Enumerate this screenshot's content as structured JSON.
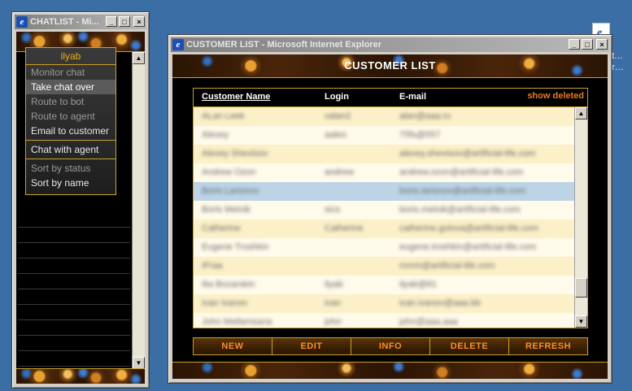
{
  "chat_window": {
    "title": "CHATLIST - Mi...",
    "buttons": {
      "minimize": "_",
      "maximize": "□",
      "close": "×"
    },
    "context_menu": {
      "header": "ilyab",
      "items": [
        {
          "label": "Monitor chat",
          "state": "disabled"
        },
        {
          "label": "Take chat over",
          "state": "active"
        },
        {
          "label": "Route to bot",
          "state": "disabled"
        },
        {
          "label": "Route to agent",
          "state": "disabled"
        },
        {
          "label": "Email to customer",
          "state": "enabled"
        },
        {
          "label": "Chat with agent",
          "state": "enabled"
        },
        {
          "label": "Sort by status",
          "state": "disabled"
        },
        {
          "label": "Sort by name",
          "state": "enabled"
        }
      ]
    },
    "scroll": {
      "up": "▲",
      "down": "▼"
    }
  },
  "customer_window": {
    "title": "CUSTOMER LIST - Microsoft Internet Explorer",
    "buttons": {
      "minimize": "_",
      "maximize": "□",
      "close": "×"
    },
    "heading": "CUSTOMER LIST",
    "table": {
      "columns": {
        "name": "Customer Name",
        "login": "Login",
        "email": "E-mail"
      },
      "show_deleted": "show deleted",
      "rows": [
        {
          "name": "ALan Leek",
          "login": "valan2",
          "email": "alan@aaa.ru",
          "selected": false
        },
        {
          "name": "Alexey",
          "login": "aaleo",
          "email": "75fs@557",
          "selected": false
        },
        {
          "name": "Alexey Shevtsov",
          "login": "",
          "email": "alexey.shevtsov@artificial-life.com",
          "selected": false
        },
        {
          "name": "Andrew Ozon",
          "login": "andrew",
          "email": "andrew.ozon@artificial-life.com",
          "selected": false
        },
        {
          "name": "Boris Larionov",
          "login": "",
          "email": "boris.larionov@artificial-life.com",
          "selected": true
        },
        {
          "name": "Boris Melnik",
          "login": "sics",
          "email": "boris.melnik@artificial-life.com",
          "selected": false
        },
        {
          "name": "Catherine",
          "login": "Catherine",
          "email": "catherine.golova@artificial-life.com",
          "selected": false
        },
        {
          "name": "Eugene Troshkin",
          "login": "",
          "email": "eugene.troshkin@artificial-life.com",
          "selected": false
        },
        {
          "name": "IFraa",
          "login": "",
          "email": "mmm@artificial-life.com",
          "selected": false
        },
        {
          "name": "Ilia Bozarskin",
          "login": "ilyab",
          "email": "ilyab@81",
          "selected": false
        },
        {
          "name": "Ivan Ivanov",
          "login": "ivan",
          "email": "ivan.ivanov@aaa.bb",
          "selected": false
        },
        {
          "name": "John Mellamsana",
          "login": "john",
          "email": "john@aaa.aaa",
          "selected": false
        }
      ],
      "scroll": {
        "up": "▲",
        "down": "▼"
      }
    },
    "actions": [
      "NEW",
      "EDIT",
      "INFO",
      "DELETE",
      "REFRESH"
    ]
  },
  "desktop": {
    "icon_label": "t...\nr..."
  }
}
